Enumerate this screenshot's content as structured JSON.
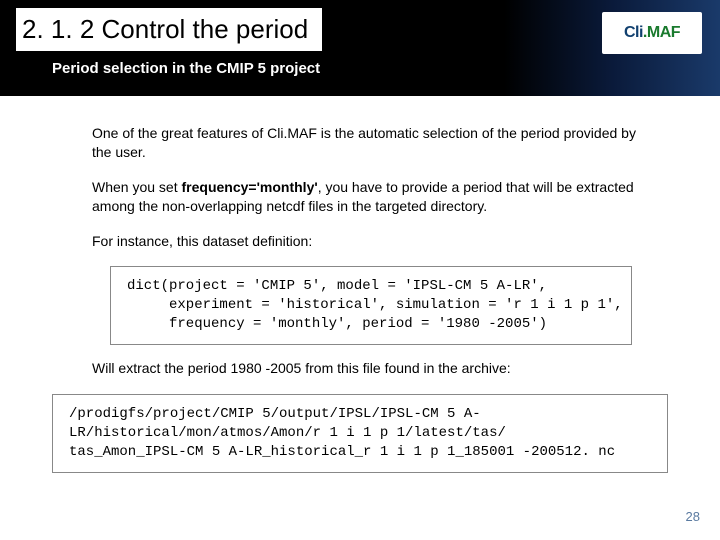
{
  "header": {
    "title": "2. 1. 2 Control the period",
    "subtitle": "Period selection in the CMIP 5 project",
    "logo": {
      "part1": "Cli",
      "dot": ".",
      "part2": "MAF"
    }
  },
  "body": {
    "para1": "One of the great features of Cli.MAF is the automatic selection of the period provided by the user.",
    "para2_a": "When you set ",
    "para2_bold": "frequency='monthly'",
    "para2_b": ", you have to provide a period that will be extracted among the non-overlapping netcdf files in the targeted directory.",
    "para3": "For instance, this dataset definition:",
    "code1": "dict(project = 'CMIP 5', model = 'IPSL-CM 5 A-LR',\n     experiment = 'historical', simulation = 'r 1 i 1 p 1',\n     frequency = 'monthly', period = '1980 -2005')",
    "para4": "Will extract the period 1980 -2005 from this file found in the archive:",
    "code2": "/prodigfs/project/CMIP 5/output/IPSL/IPSL-CM 5 A-\nLR/historical/mon/atmos/Amon/r 1 i 1 p 1/latest/tas/\ntas_Amon_IPSL-CM 5 A-LR_historical_r 1 i 1 p 1_185001 -200512. nc"
  },
  "pagenum": "28"
}
